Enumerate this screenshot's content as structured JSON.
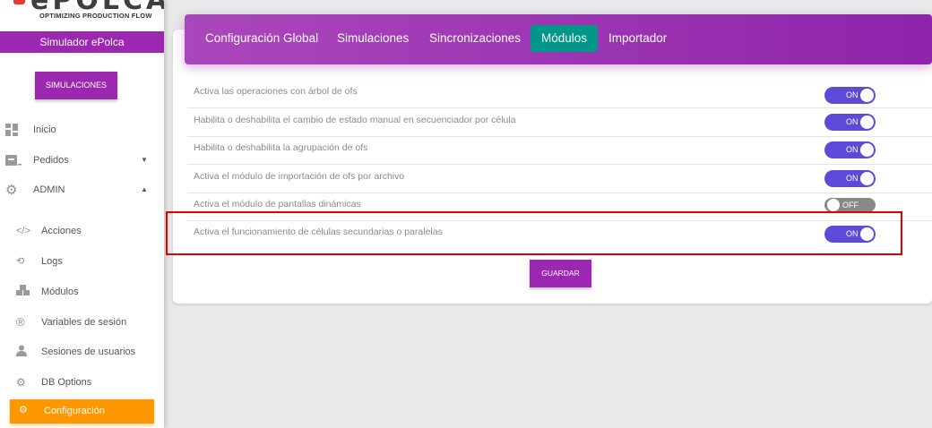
{
  "brand": {
    "logo_text": "ePOLCA",
    "tagline": "OPTIMIZING PRODUCTION FLOW",
    "accent": "#9c27b0",
    "logo_dot": "#e53935"
  },
  "sidebar": {
    "title": "Simulador ePolca",
    "button_label": "SIMULACIONES",
    "items": [
      {
        "label": "Inicio",
        "icon": "dashboard-icon"
      },
      {
        "label": "Pedidos",
        "icon": "inbox-icon",
        "caret": "▼"
      },
      {
        "label": "ADMIN",
        "icon": "gears-icon",
        "caret": "▲"
      }
    ],
    "subitems": [
      {
        "label": "Acciones",
        "icon": "code-icon"
      },
      {
        "label": "Logs",
        "icon": "history-icon"
      },
      {
        "label": "Módulos",
        "icon": "cubes-icon"
      },
      {
        "label": "Variables de sesión",
        "icon": "registered-icon"
      },
      {
        "label": "Sesiones de usuarios",
        "icon": "user-icon"
      },
      {
        "label": "DB Options",
        "icon": "cogs-icon"
      }
    ],
    "active_item": {
      "label": "Configuración",
      "icon": "cogs-icon",
      "color": "#ff9800"
    }
  },
  "tabs": [
    {
      "label": "Configuración Global"
    },
    {
      "label": "Simulaciones"
    },
    {
      "label": "Sincronizaciones"
    },
    {
      "label": "Módulos",
      "active": true
    },
    {
      "label": "Importador"
    }
  ],
  "active_tab_color": "#009688",
  "settings": [
    {
      "text": "Activa las operaciones con árbol de ofs",
      "state": "ON"
    },
    {
      "text": "Habilita o deshabilita el cambio de estado manual en secuenciador por célula",
      "state": "ON"
    },
    {
      "text": "Habilita o deshabilita la agrupación de ofs",
      "state": "ON"
    },
    {
      "text": "Activa el módulo de importación de ofs por archivo",
      "state": "ON"
    },
    {
      "text": "Activa el módulo de pantallas dinámicas",
      "state": "OFF"
    },
    {
      "text": "Activa el funcionamiento de células secundarias o paralelas",
      "state": "ON"
    }
  ],
  "toggle_colors": {
    "on": "#5c4bd9",
    "off": "#888888"
  },
  "save_label": "GUARDAR"
}
